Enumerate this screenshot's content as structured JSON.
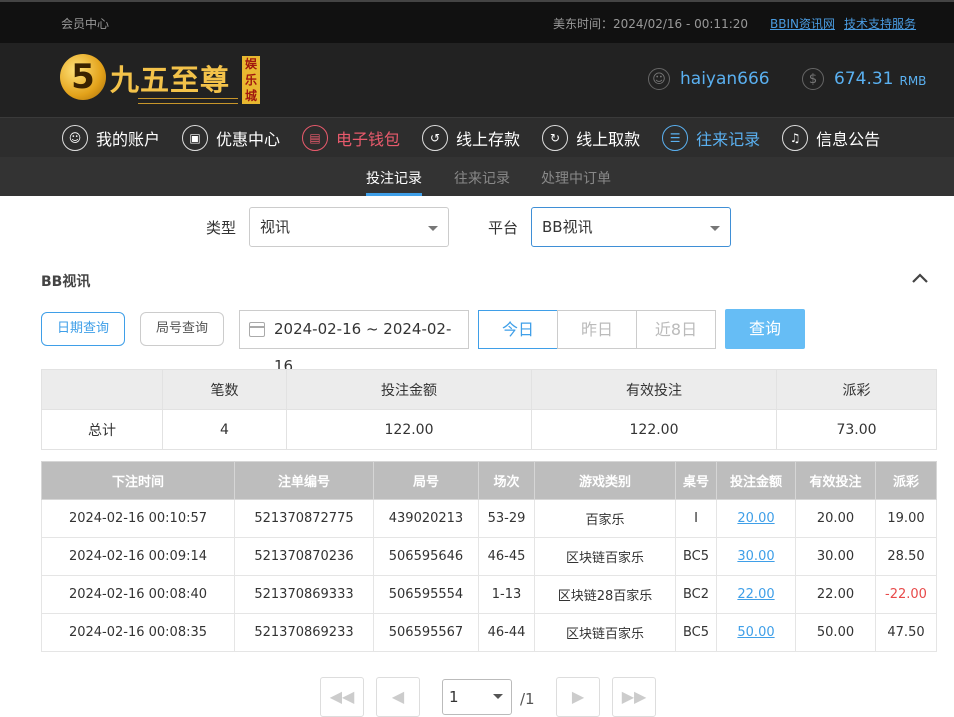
{
  "topbar": {
    "member_center": "会员中心",
    "time_label": "美东时间：2024/02/16 - 00:11:20",
    "link_bbin": "BBIN资讯网",
    "link_support": "技术支持服务"
  },
  "header": {
    "logo_mark": "5",
    "logo_text": "九五至尊",
    "logo_badge": "娱乐城",
    "username": "haiyan666",
    "balance": "674.31",
    "currency": "RMB"
  },
  "nav": [
    {
      "label": "我的账户",
      "icon": "user-icon"
    },
    {
      "label": "优惠中心",
      "icon": "gift-icon"
    },
    {
      "label": "电子钱包",
      "icon": "wallet-icon"
    },
    {
      "label": "线上存款",
      "icon": "deposit-icon"
    },
    {
      "label": "线上取款",
      "icon": "withdraw-icon"
    },
    {
      "label": "往来记录",
      "icon": "record-icon"
    },
    {
      "label": "信息公告",
      "icon": "bell-icon"
    }
  ],
  "subnav": {
    "tab_bets": "投注记录",
    "tab_transactions": "往来记录",
    "tab_pending": "处理中订单"
  },
  "filters": {
    "type_label": "类型",
    "type_value": "视讯",
    "platform_label": "平台",
    "platform_value": "BB视讯"
  },
  "section": {
    "title": "BB视讯"
  },
  "query": {
    "date_query": "日期查询",
    "round_query": "局号查询",
    "date_range": "2024-02-16 ~ 2024-02-16",
    "today": "今日",
    "yesterday": "昨日",
    "last8": "近8日",
    "search": "查询"
  },
  "summary": {
    "headers": [
      "",
      "笔数",
      "投注金额",
      "有效投注",
      "派彩"
    ],
    "row": [
      "总计",
      "4",
      "122.00",
      "122.00",
      "73.00"
    ]
  },
  "details": {
    "headers": [
      "下注时间",
      "注单编号",
      "局号",
      "场次",
      "游戏类别",
      "桌号",
      "投注金额",
      "有效投注",
      "派彩"
    ],
    "rows": [
      [
        "2024-02-16 00:10:57",
        "521370872775",
        "439020213",
        "53-29",
        "百家乐",
        "I",
        "20.00",
        "20.00",
        "19.00"
      ],
      [
        "2024-02-16 00:09:14",
        "521370870236",
        "506595646",
        "46-45",
        "区块链百家乐",
        "BC5",
        "30.00",
        "30.00",
        "28.50"
      ],
      [
        "2024-02-16 00:08:40",
        "521370869333",
        "506595554",
        "1-13",
        "区块链28百家乐",
        "BC2",
        "22.00",
        "22.00",
        "-22.00"
      ],
      [
        "2024-02-16 00:08:35",
        "521370869233",
        "506595567",
        "46-44",
        "区块链百家乐",
        "BC5",
        "50.00",
        "50.00",
        "47.50"
      ]
    ]
  },
  "pagination": {
    "first": "◀◀",
    "prev": "◀",
    "page": "1",
    "total": "/1",
    "next": "▶",
    "last": "▶▶"
  }
}
